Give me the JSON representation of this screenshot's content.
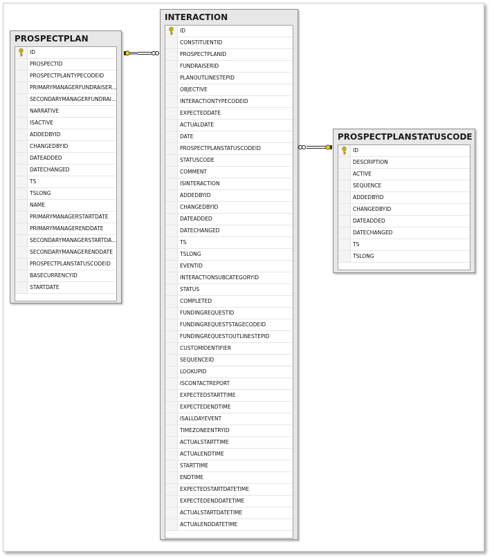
{
  "diagram": {
    "tables": [
      {
        "id": "prospectplan",
        "title": "PROSPECTPLAN",
        "columns": [
          "ID",
          "PROSPECTID",
          "PROSPECTPLANTYPECODEID",
          "PRIMARYMANAGERFUNDRAISER...",
          "SECONDARYMANAGERFUNDRAI...",
          "NARRATIVE",
          "ISACTIVE",
          "ADDEDBYID",
          "CHANGEDBYID",
          "DATEADDED",
          "DATECHANGED",
          "TS",
          "TSLONG",
          "NAME",
          "PRIMARYMANAGERSTARTDATE",
          "PRIMARYMANAGERENDDATE",
          "SECONDARYMANAGERSTARTDA...",
          "SECONDARYMANAGERENDDATE",
          "PROSPECTPLANSTATUSCODEID",
          "BASECURRENCYID",
          "STARTDATE"
        ],
        "primary_key": [
          "ID"
        ]
      },
      {
        "id": "interaction",
        "title": "INTERACTION",
        "columns": [
          "ID",
          "CONSTITUENTID",
          "PROSPECTPLANID",
          "FUNDRAISERID",
          "PLANOUTLINESTEPID",
          "OBJECTIVE",
          "INTERACTIONTYPECODEID",
          "EXPECTEDDATE",
          "ACTUALDATE",
          "DATE",
          "PROSPECTPLANSTATUSCODEID",
          "STATUSCODE",
          "COMMENT",
          "ISINTERACTION",
          "ADDEDBYID",
          "CHANGEDBYID",
          "DATEADDED",
          "DATECHANGED",
          "TS",
          "TSLONG",
          "EVENTID",
          "INTERACTIONSUBCATEGORYID",
          "STATUS",
          "COMPLETED",
          "FUNDINGREQUESTID",
          "FUNDINGREQUESTSTAGECODEID",
          "FUNDINGREQUESTOUTLINESTEPID",
          "CUSTOMIDENTIFIER",
          "SEQUENCEID",
          "LOOKUPID",
          "ISCONTACTREPORT",
          "EXPECTEDSTARTTIME",
          "EXPECTEDENDTIME",
          "ISALLDAYEVENT",
          "TIMEZONEENTRYID",
          "ACTUALSTARTTIME",
          "ACTUALENDTIME",
          "STARTTIME",
          "ENDTIME",
          "EXPECTEDSTARTDATETIME",
          "EXPECTEDENDDATETIME",
          "ACTUALSTARTDATETIME",
          "ACTUALENDDATETIME"
        ],
        "primary_key": [
          "ID"
        ]
      },
      {
        "id": "prospectplanstatuscode",
        "title": "PROSPECTPLANSTATUSCODE",
        "columns": [
          "ID",
          "DESCRIPTION",
          "ACTIVE",
          "SEQUENCE",
          "ADDEDBYID",
          "CHANGEDBYID",
          "DATEADDED",
          "DATECHANGED",
          "TS",
          "TSLONG"
        ],
        "primary_key": [
          "ID"
        ]
      }
    ],
    "relationships": [
      {
        "from": "prospectplan",
        "to": "interaction",
        "one_end": "prospectplan",
        "many_end": "interaction"
      },
      {
        "from": "prospectplanstatuscode",
        "to": "interaction",
        "one_end": "prospectplanstatuscode",
        "many_end": "interaction"
      }
    ],
    "colors": {
      "key_icon": "#e8c000",
      "title_bg": "#e7e7e7",
      "connector": "#222222"
    }
  }
}
